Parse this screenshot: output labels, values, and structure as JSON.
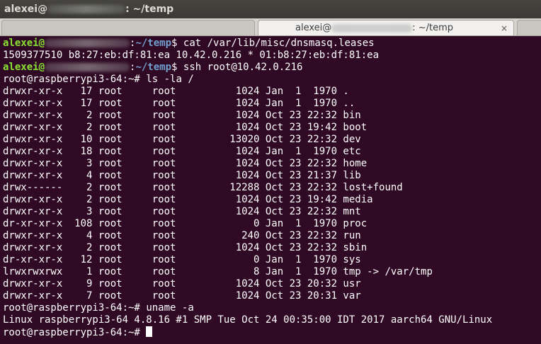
{
  "window": {
    "title_user": "alexei@",
    "title_path": ": ~/temp"
  },
  "tabs": [
    {
      "label_user": "alexei@",
      "label_path": ": ~/temp",
      "active": true,
      "close": "×"
    }
  ],
  "terminal": {
    "prompt_user": "alexei@",
    "prompt_path": "~/temp",
    "cmd_cat": "cat /var/lib/misc/dnsmasq.leases",
    "lease": "1509377510 b8:27:eb:df:81:ea 10.42.0.216 * 01:b8:27:eb:df:81:ea",
    "cmd_ssh": "ssh root@10.42.0.216",
    "root_prompt": "root@raspberrypi3-64:~#",
    "cmd_ls": "ls -la /",
    "ls": [
      "drwxr-xr-x   17 root     root          1024 Jan  1  1970 .",
      "drwxr-xr-x   17 root     root          1024 Jan  1  1970 ..",
      "drwxr-xr-x    2 root     root          1024 Oct 23 22:32 bin",
      "drwxr-xr-x    2 root     root          1024 Oct 23 19:42 boot",
      "drwxr-xr-x   10 root     root         13020 Oct 23 22:32 dev",
      "drwxr-xr-x   18 root     root          1024 Jan  1  1970 etc",
      "drwxr-xr-x    3 root     root          1024 Oct 23 22:32 home",
      "drwxr-xr-x    4 root     root          1024 Oct 23 21:37 lib",
      "drwx------    2 root     root         12288 Oct 23 22:32 lost+found",
      "drwxr-xr-x    2 root     root          1024 Oct 23 19:42 media",
      "drwxr-xr-x    3 root     root          1024 Oct 23 22:32 mnt",
      "dr-xr-xr-x  108 root     root             0 Jan  1  1970 proc",
      "drwxr-xr-x    4 root     root           240 Oct 23 22:32 run",
      "drwxr-xr-x    2 root     root          1024 Oct 23 22:32 sbin",
      "dr-xr-xr-x   12 root     root             0 Jan  1  1970 sys",
      "lrwxrwxrwx    1 root     root             8 Jan  1  1970 tmp -> /var/tmp",
      "drwxr-xr-x    9 root     root          1024 Oct 23 20:32 usr",
      "drwxr-xr-x    7 root     root          1024 Oct 23 20:31 var"
    ],
    "cmd_uname": "uname -a",
    "uname_out": "Linux raspberrypi3-64 4.8.16 #1 SMP Tue Oct 24 00:35:00 IDT 2017 aarch64 GNU/Linux"
  },
  "colors": {
    "background": "#300a24",
    "prompt_user": "#8ae234",
    "prompt_path": "#729fcf",
    "text": "#ffffff"
  }
}
